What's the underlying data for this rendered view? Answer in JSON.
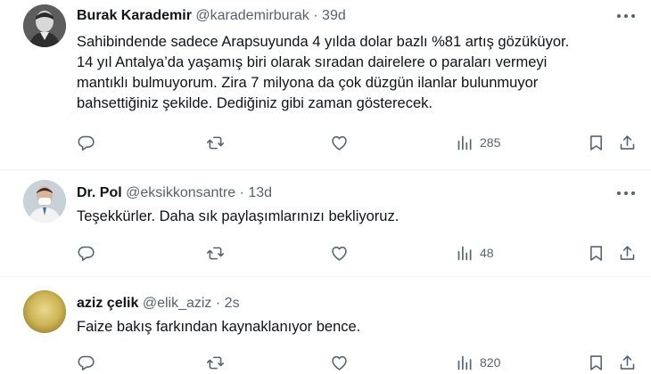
{
  "tweets": [
    {
      "author_name": "Burak Karademir",
      "author_handle": "@karademirburak",
      "separator": "·",
      "time": "39d",
      "text_lines": [
        "Sahibindende sadece Arapsuyunda 4 yılda dolar bazlı %81 artış gözüküyor.",
        "14 yıl Antalya’da yaşamış biri olarak sıradan dairelere o paraları vermeyi",
        "mantıklı bulmuyorum. Zira 7 milyona da çok düzgün ilanlar bulunmuyor",
        "bahsettiğiniz şekilde. Dediğiniz gibi zaman gösterecek."
      ],
      "views": "285",
      "avatar_icon": "person-photo-avatar"
    },
    {
      "author_name": "Dr. Pol",
      "author_handle": "@eksikkonsantre",
      "separator": "·",
      "time": "13d",
      "text_lines": [
        "Teşekkürler. Daha sık paylaşımlarınızı bekliyoruz."
      ],
      "views": "48",
      "avatar_icon": "doctor-photo-avatar"
    },
    {
      "author_name": "aziz çelik",
      "author_handle": "@elik_aziz",
      "separator": "·",
      "time": "2s",
      "text_lines": [
        "Faize bakış farkından kaynaklanıyor bence."
      ],
      "views": "820",
      "avatar_icon": "blurred-photo-avatar"
    }
  ],
  "colors": {
    "text_primary": "#0f1419",
    "text_secondary": "#536471",
    "divider": "#eff3f4",
    "background": "#ffffff"
  },
  "icons": [
    "reply-icon",
    "retweet-icon",
    "like-icon",
    "views-icon",
    "bookmark-icon",
    "share-icon",
    "more-icon"
  ]
}
